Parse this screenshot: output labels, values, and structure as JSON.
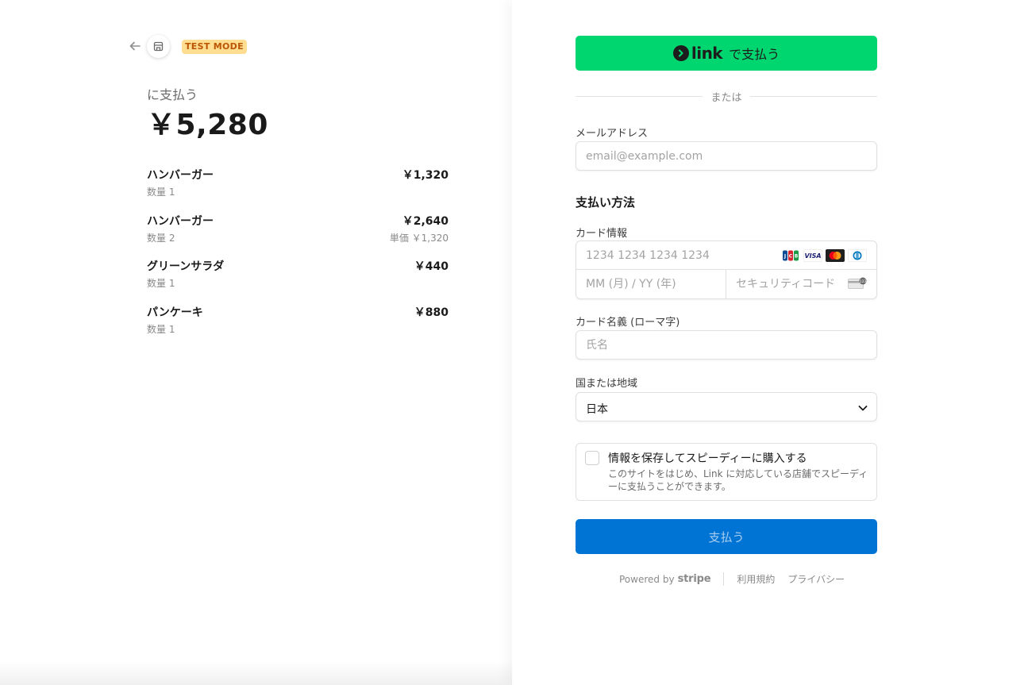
{
  "header": {
    "test_mode_badge": "TEST MODE"
  },
  "summary": {
    "pay_to_label": "に支払う",
    "total": "￥5,280",
    "items": [
      {
        "name": "ハンバーガー",
        "qty": "数量 1",
        "price": "￥1,320",
        "unit_price": ""
      },
      {
        "name": "ハンバーガー",
        "qty": "数量 2",
        "price": "￥2,640",
        "unit_price": "単価 ￥1,320"
      },
      {
        "name": "グリーンサラダ",
        "qty": "数量 1",
        "price": "￥440",
        "unit_price": ""
      },
      {
        "name": "パンケーキ",
        "qty": "数量 1",
        "price": "￥880",
        "unit_price": ""
      }
    ]
  },
  "form": {
    "link_button": {
      "brand": "link",
      "text": "で支払う"
    },
    "divider_text": "または",
    "email": {
      "label": "メールアドレス",
      "placeholder": "email@example.com",
      "value": ""
    },
    "payment_method_title": "支払い方法",
    "card": {
      "label": "カード情報",
      "number_placeholder": "1234 1234 1234 1234",
      "expiry_placeholder": "MM (月) / YY (年)",
      "cvc_placeholder": "セキュリティコード",
      "brands": [
        "jcb-icon",
        "visa-icon",
        "mastercard-icon",
        "diners-icon"
      ],
      "visa_text": "VISA"
    },
    "cardholder": {
      "label": "カード名義 (ローマ字)",
      "placeholder": "氏名"
    },
    "country": {
      "label": "国または地域",
      "value": "日本"
    },
    "save_info": {
      "title": "情報を保存してスピーディーに購入する",
      "description": "このサイトをはじめ、Link に対応している店舗でスピーディーに支払うことができます。",
      "checked": false
    },
    "pay_button": "支払う"
  },
  "footer": {
    "powered_by": "Powered by",
    "stripe": "stripe",
    "terms": "利用規約",
    "privacy": "プライバシー"
  },
  "colors": {
    "link_green": "#00d66f",
    "pay_blue": "#0074d4",
    "test_mode_bg": "#ffde92",
    "test_mode_text": "#bb5504"
  }
}
